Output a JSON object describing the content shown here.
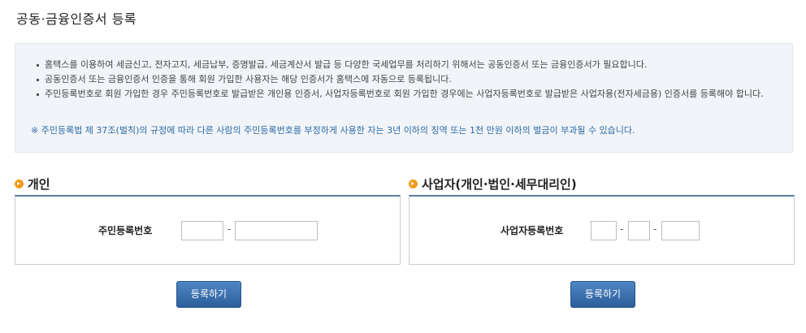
{
  "page": {
    "title": "공동·금융인증서 등록"
  },
  "notice": {
    "items": [
      "홈택스를 이용하여 세금신고, 전자고지, 세금납부, 증명발급, 세금계산서 발급 등 다양한 국세업무를 처리하기 위해서는 공동인증서 또는 금융인증서가 필요합니다.",
      "공동인증서 또는 금융인증서 인증을 통해 회원 가입한 사용자는 해당 인증서가 홈택스에 자동으로 등록됩니다.",
      "주민등록번호로 회원 가입한 경우 주민등록번호로 발급받은 개인용 인증서, 사업자등록번호로 회원 가입한 경우에는 사업자등록번호로 발급받은 사업자용(전자세금용) 인증서를 등록해야 합니다."
    ],
    "warning": "※ 주민등록법 제 37조(벌칙)의 규정에 따라 다른 사람의 주민등록번호를 부정하게 사용한 자는 3년 이하의 징역 또는 1천 만원 이하의 벌금이 부과될 수 있습니다."
  },
  "individual": {
    "title": "개인",
    "field_label": "주민등록번호",
    "separator": "-",
    "first_value": "",
    "second_value": "",
    "button_label": "등록하기"
  },
  "business": {
    "title": "사업자(개인·법인·세무대리인)",
    "field_label": "사업자등록번호",
    "separator": "-",
    "part1_value": "",
    "part2_value": "",
    "part3_value": "",
    "button_label": "등록하기"
  },
  "colors": {
    "accent": "#2c5f9c",
    "section_icon": "#f29a1a",
    "warning_text": "#2f6aa6",
    "notice_bg": "#f1f4f8"
  }
}
